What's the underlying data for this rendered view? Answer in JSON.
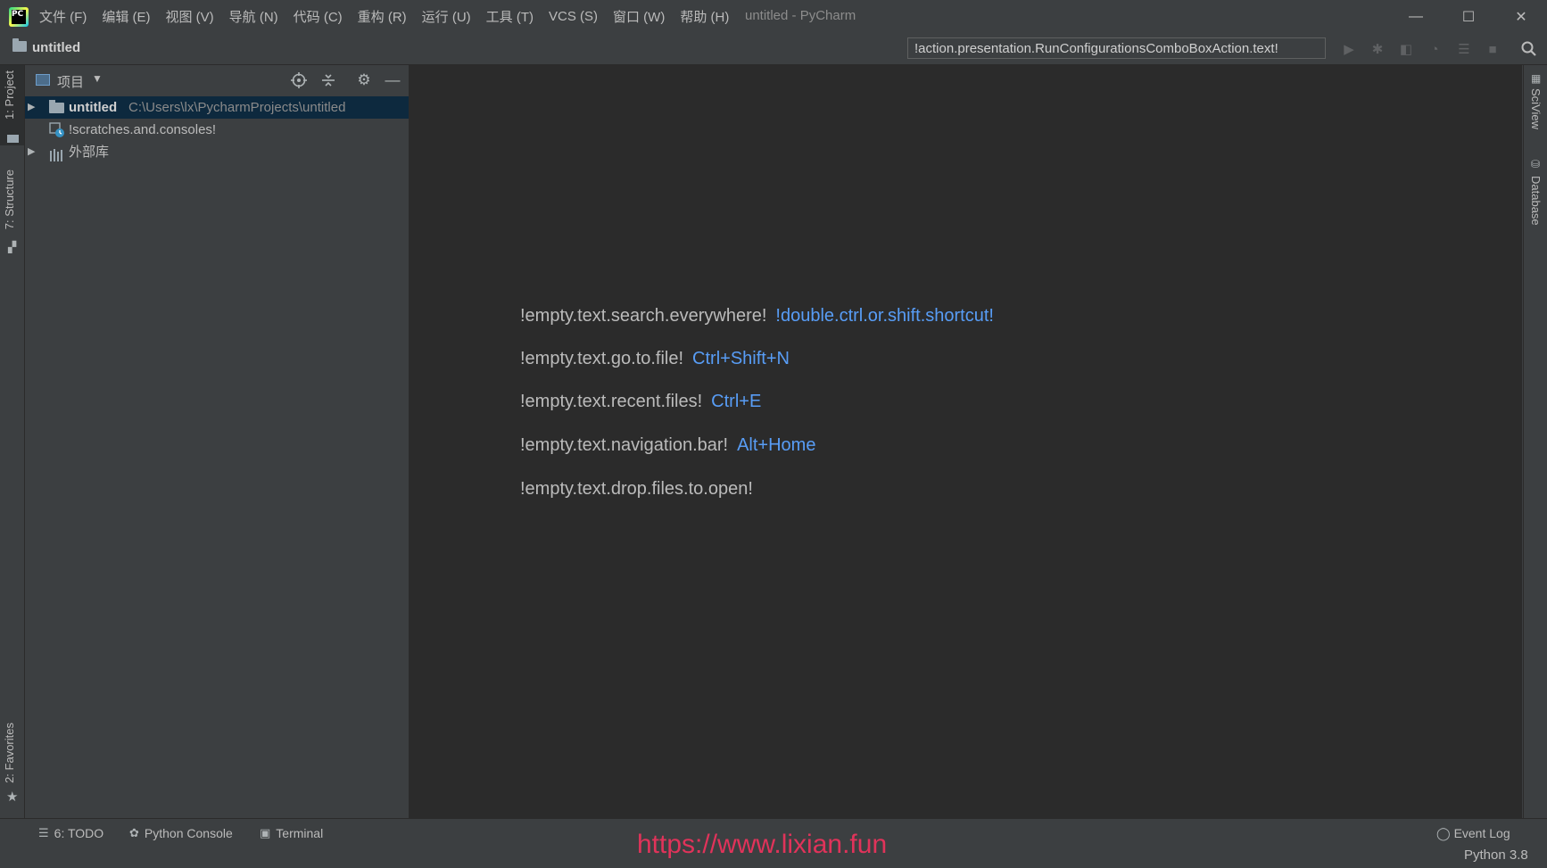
{
  "window": {
    "title": "untitled - PyCharm",
    "minimize_label": "—",
    "maximize_label": "☐",
    "close_label": "✕"
  },
  "menu": [
    "文件 (F)",
    "编辑 (E)",
    "视图 (V)",
    "导航 (N)",
    "代码 (C)",
    "重构 (R)",
    "运行 (U)",
    "工具 (T)",
    "VCS (S)",
    "窗口 (W)",
    "帮助 (H)"
  ],
  "navbar": {
    "breadcrumb": "untitled",
    "run_config": "!action.presentation.RunConfigurationsComboBoxAction.text!"
  },
  "left_strip": {
    "project_tab": "1: Project",
    "structure_tab": "7: Structure",
    "favorites_tab": "2: Favorites"
  },
  "right_strip": {
    "sciview_tab": "SciView",
    "database_tab": "Database"
  },
  "project_panel": {
    "title": "项目",
    "tree": [
      {
        "label": "untitled",
        "path": "C:\\Users\\lx\\PycharmProjects\\untitled",
        "icon": "folder-icon",
        "expandable": true,
        "selected": true
      },
      {
        "label": "!scratches.and.consoles!",
        "path": "",
        "icon": "scratches-icon",
        "expandable": false,
        "selected": false
      },
      {
        "label": "外部库",
        "path": "",
        "icon": "library-icon",
        "expandable": true,
        "selected": false
      }
    ]
  },
  "editor": {
    "hints": [
      {
        "text": "!empty.text.search.everywhere!",
        "shortcut": "!double.ctrl.or.shift.shortcut!"
      },
      {
        "text": "!empty.text.go.to.file!",
        "shortcut": "Ctrl+Shift+N"
      },
      {
        "text": "!empty.text.recent.files!",
        "shortcut": "Ctrl+E"
      },
      {
        "text": "!empty.text.navigation.bar!",
        "shortcut": "Alt+Home"
      },
      {
        "text": "!empty.text.drop.files.to.open!",
        "shortcut": ""
      }
    ]
  },
  "bottom": {
    "todo_tab": "6: TODO",
    "python_console_tab": "Python Console",
    "terminal_tab": "Terminal",
    "watermark": "https://www.lixian.fun",
    "event_log": "Event Log",
    "interpreter": "Python 3.8"
  },
  "colors": {
    "background": "#3c3f41",
    "editor_background": "#2b2b2b",
    "shortcut_blue": "#589df6",
    "selection": "#0d293e",
    "watermark_red": "#e0335a"
  }
}
